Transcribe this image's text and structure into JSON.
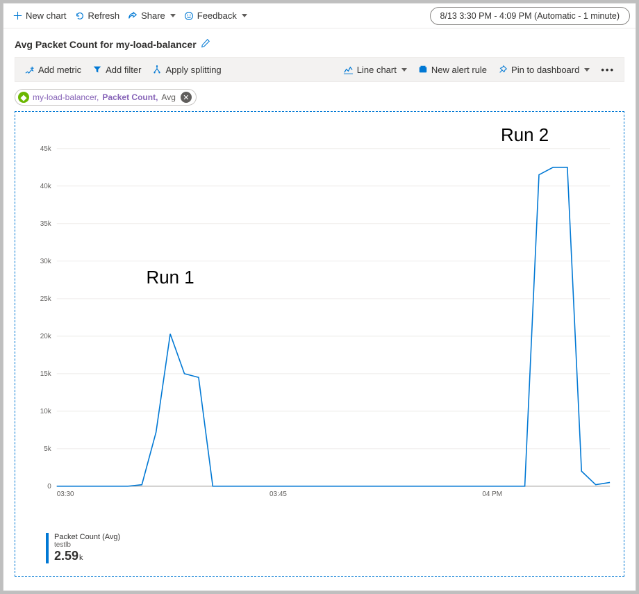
{
  "top": {
    "new_chart": "New chart",
    "refresh": "Refresh",
    "share": "Share",
    "feedback": "Feedback",
    "timerange": "8/13 3:30 PM - 4:09 PM (Automatic - 1 minute)"
  },
  "title": "Avg Packet Count for my-load-balancer",
  "toolbar": {
    "add_metric": "Add metric",
    "add_filter": "Add filter",
    "apply_splitting": "Apply splitting",
    "chart_type": "Line chart",
    "new_alert": "New alert rule",
    "pin": "Pin to dashboard"
  },
  "chip": {
    "resource": "my-load-balancer",
    "metric": "Packet Count",
    "agg": "Avg"
  },
  "chart_data": {
    "type": "line",
    "title": "Avg Packet Count for my-load-balancer",
    "ylabel": "",
    "xlabel": "",
    "ylim": [
      0,
      47000
    ],
    "y_ticks": [
      0,
      5000,
      10000,
      15000,
      20000,
      25000,
      30000,
      35000,
      40000,
      45000
    ],
    "y_tick_labels": [
      "0",
      "5k",
      "10k",
      "15k",
      "20k",
      "25k",
      "30k",
      "35k",
      "40k",
      "45k"
    ],
    "x_major_ticks": [
      "03:30",
      "03:45",
      "04 PM"
    ],
    "x": [
      0,
      1,
      2,
      3,
      4,
      5,
      6,
      7,
      8,
      9,
      10,
      11,
      12,
      13,
      14,
      15,
      16,
      17,
      18,
      19,
      20,
      21,
      22,
      23,
      24,
      25,
      26,
      27,
      28,
      29,
      30,
      31,
      32,
      33,
      34,
      35,
      36,
      37,
      38,
      39
    ],
    "values": [
      0,
      0,
      0,
      0,
      0,
      0,
      200,
      7200,
      20300,
      15000,
      14500,
      0,
      0,
      0,
      0,
      0,
      0,
      0,
      0,
      0,
      0,
      0,
      0,
      0,
      0,
      0,
      0,
      0,
      0,
      0,
      0,
      0,
      0,
      0,
      41500,
      42500,
      42500,
      2000,
      200,
      500
    ],
    "annotations": [
      {
        "text": "Run 1",
        "x": 8,
        "y": 27000
      },
      {
        "text": "Run 2",
        "x": 33,
        "y": 46000
      }
    ]
  },
  "legend": {
    "line1": "Packet Count (Avg)",
    "line2": "testlb",
    "value": "2.59",
    "unit": "k"
  }
}
